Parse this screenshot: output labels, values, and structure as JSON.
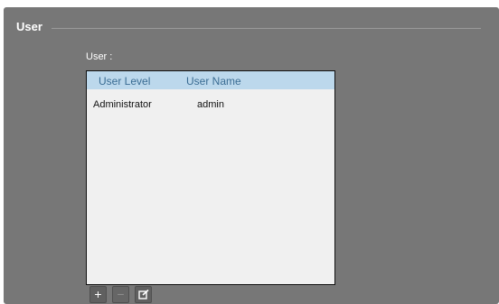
{
  "section": {
    "title": "User"
  },
  "user_list": {
    "label": "User :",
    "columns": [
      "User Level",
      "User Name"
    ],
    "rows": [
      {
        "level": "Administrator",
        "name": "admin"
      }
    ]
  },
  "toolbar": {
    "add_label": "+",
    "remove_label": "−",
    "edit_icon": "edit-icon"
  }
}
